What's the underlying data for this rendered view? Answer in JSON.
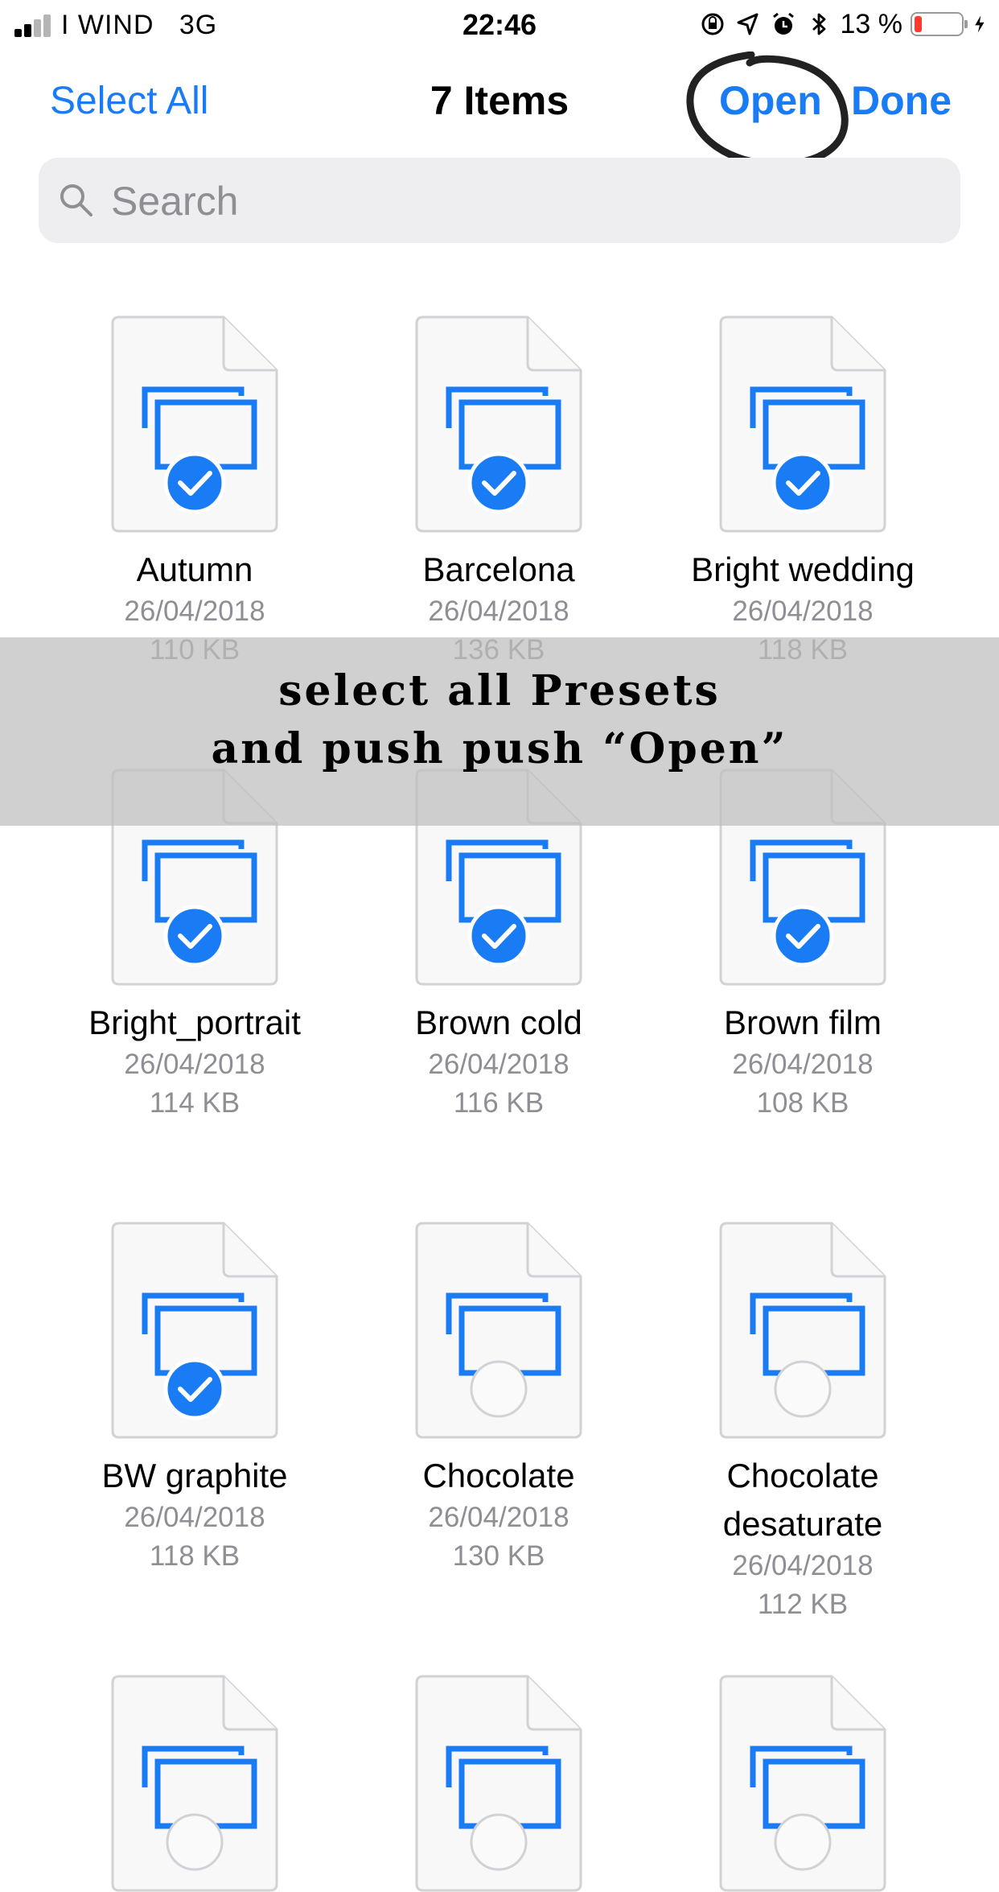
{
  "status_bar": {
    "carrier": "I WIND",
    "network": "3G",
    "time": "22:46",
    "battery": "13 %",
    "icons": [
      "signal-bars-icon",
      "orientation-lock-icon",
      "location-arrow-icon",
      "alarm-icon",
      "bluetooth-icon",
      "battery-icon",
      "charging-bolt-icon"
    ]
  },
  "nav": {
    "select_all": "Select All",
    "title": "7 Items",
    "open": "Open",
    "done": "Done"
  },
  "search": {
    "placeholder": "Search"
  },
  "colors": {
    "accent": "#1a7cf5",
    "secondary_text": "#8e8e93",
    "annotation": "#222222"
  },
  "files": [
    {
      "name": "Autumn",
      "date": "26/04/2018",
      "size": "110 KB",
      "selected": true
    },
    {
      "name": "Barcelona",
      "date": "26/04/2018",
      "size": "136 KB",
      "selected": true
    },
    {
      "name": "Bright wedding",
      "date": "26/04/2018",
      "size": "118 KB",
      "selected": true
    },
    {
      "name": "Bright_portrait",
      "date": "26/04/2018",
      "size": "114 KB",
      "selected": true
    },
    {
      "name": "Brown cold",
      "date": "26/04/2018",
      "size": "116 KB",
      "selected": true
    },
    {
      "name": "Brown film",
      "date": "26/04/2018",
      "size": "108 KB",
      "selected": true
    },
    {
      "name": "BW graphite",
      "date": "26/04/2018",
      "size": "118 KB",
      "selected": true
    },
    {
      "name": "Chocolate",
      "date": "26/04/2018",
      "size": "130 KB",
      "selected": false
    },
    {
      "name": "Chocolate desaturate",
      "name_lines": [
        "Chocolate",
        "desaturate"
      ],
      "date": "26/04/2018",
      "size": "112 KB",
      "selected": false
    }
  ],
  "banner": {
    "line1": "select all Presets",
    "line2": "and push push “Open”"
  }
}
